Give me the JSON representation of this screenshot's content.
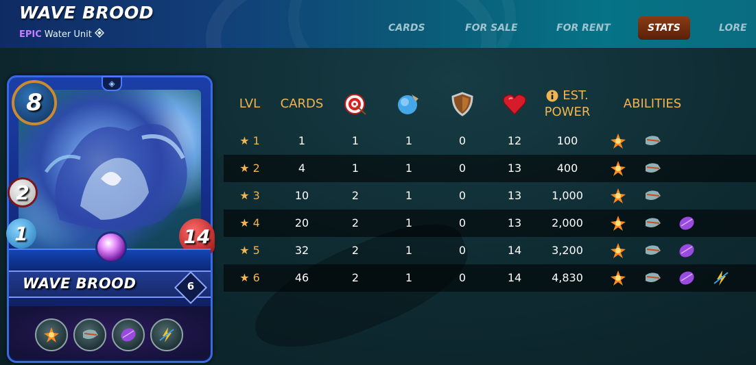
{
  "header": {
    "title": "WAVE BROOD",
    "rarity": "EPIC",
    "element": "Water Unit",
    "element_icon": "water-icon"
  },
  "nav": {
    "tabs": [
      {
        "label": "CARDS",
        "active": false
      },
      {
        "label": "FOR SALE",
        "active": false
      },
      {
        "label": "FOR RENT",
        "active": false
      },
      {
        "label": "STATS",
        "active": true
      },
      {
        "label": "LORE",
        "active": false
      }
    ]
  },
  "card": {
    "mana": "8",
    "ranged": "2",
    "speed": "1",
    "health": "14",
    "name": "WAVE BROOD",
    "level": "6",
    "abilities": [
      "fire-flower-ability-icon",
      "scavenger-ability-icon",
      "shield-shell-ability-icon",
      "lightning-ability-icon"
    ]
  },
  "table": {
    "headers": {
      "lvl": "LVL",
      "cards": "CARDS",
      "ranged_icon": "ranged-attack-icon",
      "speed_icon": "speed-icon",
      "armor_icon": "armor-icon",
      "health_icon": "health-icon",
      "power_info_icon": "info-icon",
      "power_line1": "EST.",
      "power_line2": "POWER",
      "abilities": "ABILITIES"
    },
    "rows": [
      {
        "lvl": "★ 1",
        "cards": "1",
        "ranged": "1",
        "speed": "1",
        "armor": "0",
        "health": "12",
        "power": "100",
        "abilities": [
          "fire-flower-ability-icon",
          "scavenger-ability-icon"
        ]
      },
      {
        "lvl": "★ 2",
        "cards": "4",
        "ranged": "1",
        "speed": "1",
        "armor": "0",
        "health": "13",
        "power": "400",
        "abilities": [
          "fire-flower-ability-icon",
          "scavenger-ability-icon"
        ]
      },
      {
        "lvl": "★ 3",
        "cards": "10",
        "ranged": "2",
        "speed": "1",
        "armor": "0",
        "health": "13",
        "power": "1,000",
        "abilities": [
          "fire-flower-ability-icon",
          "scavenger-ability-icon"
        ]
      },
      {
        "lvl": "★ 4",
        "cards": "20",
        "ranged": "2",
        "speed": "1",
        "armor": "0",
        "health": "13",
        "power": "2,000",
        "abilities": [
          "fire-flower-ability-icon",
          "scavenger-ability-icon",
          "shield-shell-ability-icon"
        ]
      },
      {
        "lvl": "★ 5",
        "cards": "32",
        "ranged": "2",
        "speed": "1",
        "armor": "0",
        "health": "14",
        "power": "3,200",
        "abilities": [
          "fire-flower-ability-icon",
          "scavenger-ability-icon",
          "shield-shell-ability-icon"
        ]
      },
      {
        "lvl": "★ 6",
        "cards": "46",
        "ranged": "2",
        "speed": "1",
        "armor": "0",
        "health": "14",
        "power": "4,830",
        "abilities": [
          "fire-flower-ability-icon",
          "scavenger-ability-icon",
          "shield-shell-ability-icon",
          "lightning-ability-icon"
        ]
      }
    ]
  },
  "colors": {
    "accent_gold": "#f0b552",
    "active_tab": "#8a3b14",
    "rarity_epic": "#c77dff"
  }
}
